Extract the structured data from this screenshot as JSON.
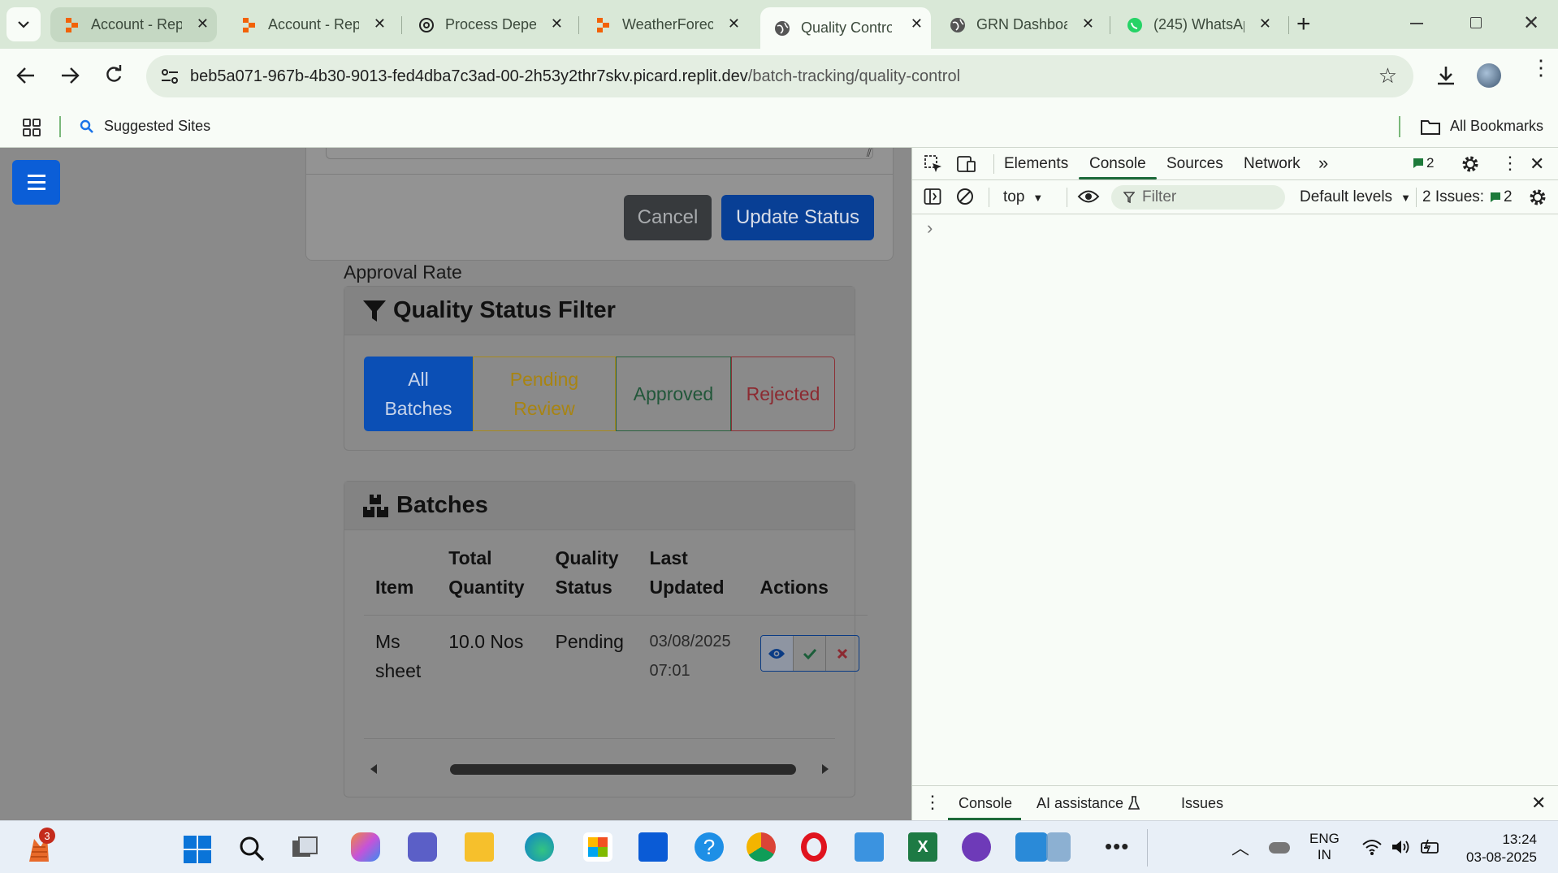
{
  "browser": {
    "tabs": [
      {
        "title": "Account - Rep",
        "icon": "replit-icon"
      },
      {
        "title": "Account - Rep",
        "icon": "replit-icon"
      },
      {
        "title": "Process Deper",
        "icon": "openai-icon"
      },
      {
        "title": "WeatherForec",
        "icon": "replit-icon"
      },
      {
        "title": "Quality Contro",
        "icon": "globe-icon",
        "active": true
      },
      {
        "title": "GRN Dashboa",
        "icon": "globe-icon"
      },
      {
        "title": "(245) WhatsAp",
        "icon": "whatsapp-icon"
      }
    ],
    "url_host": "beb5a071-967b-4b30-9013-fed4dba7c3ad-00-2h53y2thr7skv.picard.replit.dev",
    "url_path": "/batch-tracking/quality-control",
    "bookmarks": {
      "suggested": "Suggested Sites",
      "all": "All Bookmarks"
    }
  },
  "page": {
    "modal": {
      "cancel_label": "Cancel",
      "update_label": "Update Status"
    },
    "approval_label": "Approval Rate",
    "filter": {
      "title": "Quality Status Filter",
      "buttons": [
        {
          "label": "All Batches",
          "active": true,
          "color": "#0b5ed7"
        },
        {
          "label": "Pending Review",
          "color": "#c79a12"
        },
        {
          "label": "Approved",
          "color": "#1c6b3f"
        },
        {
          "label": "Rejected",
          "color": "#a52a33"
        }
      ]
    },
    "batches": {
      "title": "Batches",
      "columns": [
        "Item",
        "Total Quantity",
        "Quality Status",
        "Last Updated",
        "Actions"
      ],
      "rows": [
        {
          "item": "Ms sheet",
          "quantity": "10.0 Nos",
          "status": "Pending",
          "updated": "03/08/2025 07:01"
        }
      ]
    }
  },
  "devtools": {
    "tabs": [
      "Elements",
      "Console",
      "Sources",
      "Network"
    ],
    "active_tab": "Console",
    "message_count": "2",
    "context": "top",
    "filter_placeholder": "Filter",
    "levels": "Default levels",
    "issues_label": "2 Issues:",
    "issues_count": "2",
    "prompt": "›",
    "drawer_tabs": [
      "Console",
      "AI assistance",
      "Issues"
    ]
  },
  "taskbar": {
    "notification_badge": "3",
    "lang_top": "ENG",
    "lang_bottom": "IN",
    "time": "13:24",
    "date": "03-08-2025"
  }
}
